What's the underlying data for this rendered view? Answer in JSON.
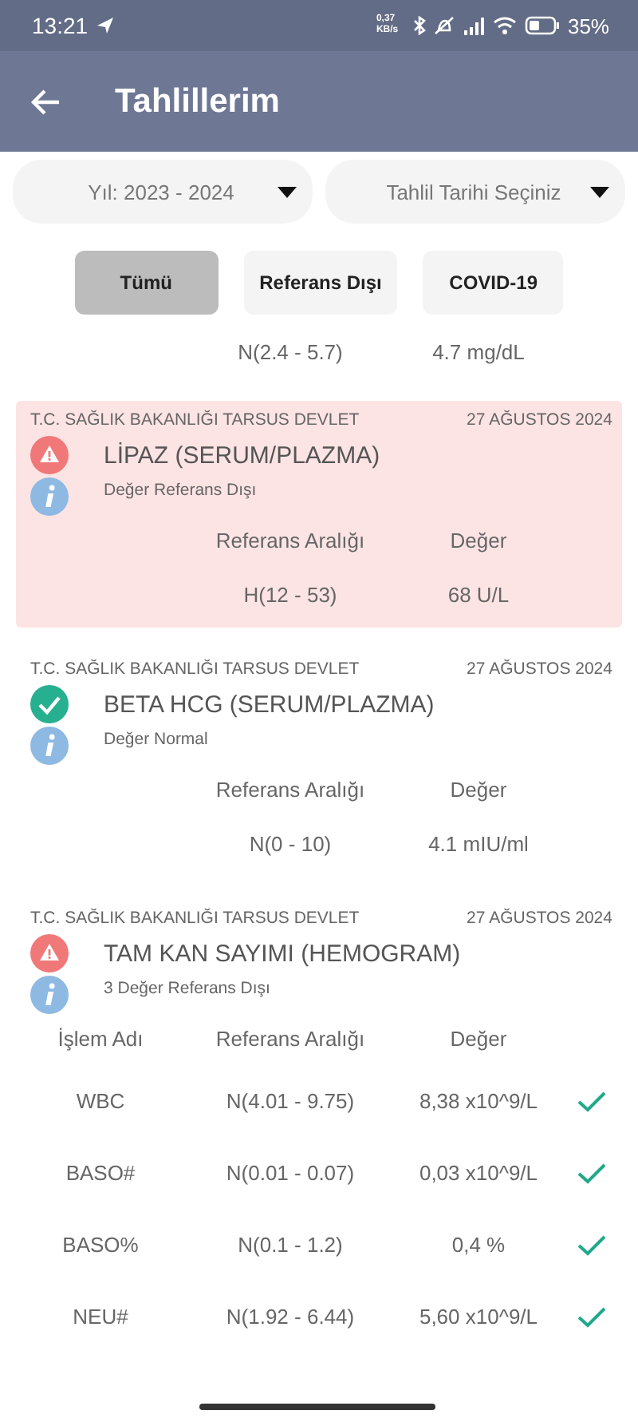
{
  "status_bar": {
    "time": "13:21",
    "speed": "0,37 KB/s",
    "battery": "35%"
  },
  "app_bar": {
    "title": "Tahlillerim"
  },
  "dropdowns": [
    {
      "value": "Yıl: 2023 - 2024"
    },
    {
      "value": "Tahlil Tarihi Seçiniz"
    }
  ],
  "filters": [
    {
      "label": "Tümü",
      "selected": true
    },
    {
      "label": "Referans Dışı",
      "selected": false
    },
    {
      "label": "COVID-19",
      "selected": false
    }
  ],
  "partial_row": {
    "reference": "N(2.4 - 5.7)",
    "value": "4.7 mg/dL"
  },
  "results": [
    {
      "institution": "T.C. SAĞLIK BAKANLIĞI TARSUS DEVLET",
      "date": "27 AĞUSTOS 2024",
      "kind": "abnormal",
      "highlighted": true,
      "name": "LİPAZ (SERUM/PLAZMA)",
      "summary": "Değer Referans Dışı",
      "headers": [
        "Referans Aralığı",
        "Değer"
      ],
      "rows": [
        {
          "reference": "H(12 - 53)",
          "value": "68 U/L"
        }
      ]
    },
    {
      "institution": "T.C. SAĞLIK BAKANLIĞI TARSUS DEVLET",
      "date": "27 AĞUSTOS 2024",
      "kind": "normal",
      "highlighted": false,
      "name": "BETA HCG (SERUM/PLAZMA)",
      "summary": "Değer Normal",
      "headers": [
        "Referans Aralığı",
        "Değer"
      ],
      "rows": [
        {
          "reference": "N(0 - 10)",
          "value": "4.1 mIU/ml"
        }
      ]
    },
    {
      "institution": "T.C. SAĞLIK BAKANLIĞI TARSUS DEVLET",
      "date": "27 AĞUSTOS 2024",
      "kind": "abnormal",
      "highlighted": false,
      "name": "TAM KAN SAYIMI (HEMOGRAM)",
      "summary": "3 Değer Referans Dışı",
      "headers": [
        "İşlem Adı",
        "Referans Aralığı",
        "Değer"
      ],
      "rows": [
        {
          "name": "WBC",
          "reference": "N(4.01 - 9.75)",
          "value": "8,38 x10^9/L",
          "normal": true
        },
        {
          "name": "BASO#",
          "reference": "N(0.01 - 0.07)",
          "value": "0,03 x10^9/L",
          "normal": true
        },
        {
          "name": "BASO%",
          "reference": "N(0.1 - 1.2)",
          "value": "0,4 %",
          "normal": true
        },
        {
          "name": "NEU#",
          "reference": "N(1.92 - 6.44)",
          "value": "5,60 x10^9/L",
          "normal": true
        }
      ]
    }
  ]
}
